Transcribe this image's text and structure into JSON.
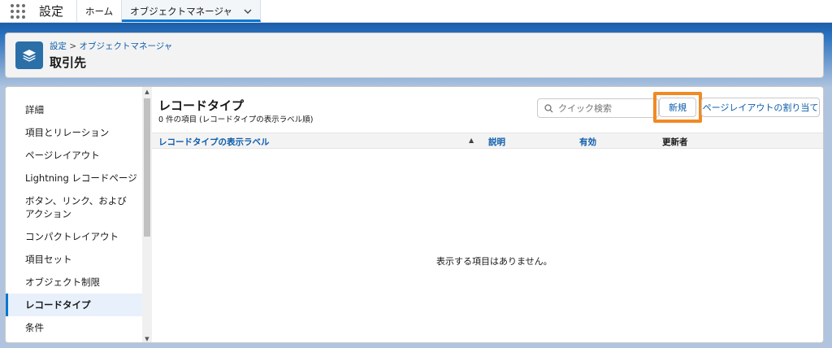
{
  "app": {
    "name": "設定"
  },
  "nav": {
    "tabs": [
      {
        "label": "ホーム"
      },
      {
        "label": "オブジェクトマネージャ"
      }
    ]
  },
  "header": {
    "breadcrumb_setup": "設定",
    "breadcrumb_sep": ">",
    "breadcrumb_objmgr": "オブジェクトマネージャ",
    "title": "取引先"
  },
  "sidebar": {
    "items": [
      {
        "label": "詳細"
      },
      {
        "label": "項目とリレーション"
      },
      {
        "label": "ページレイアウト"
      },
      {
        "label": "Lightning レコードページ"
      },
      {
        "label": "ボタン、リンク、およびアクション"
      },
      {
        "label": "コンパクトレイアウト"
      },
      {
        "label": "項目セット"
      },
      {
        "label": "オブジェクト制限"
      },
      {
        "label": "レコードタイプ"
      },
      {
        "label": "条件"
      }
    ]
  },
  "main": {
    "title": "レコードタイプ",
    "subtitle": "0 件の項目 (レコードタイプの表示ラベル順)",
    "search_placeholder": "クイック検索",
    "new_button": "新規",
    "layout_button": "ページレイアウトの割り当て",
    "columns": [
      {
        "label": "レコードタイプの表示ラベル"
      },
      {
        "label": "説明"
      },
      {
        "label": "有効"
      },
      {
        "label": "更新者"
      }
    ],
    "sort_arrow": "▲",
    "empty_message": "表示する項目はありません。"
  },
  "colors": {
    "accent": "#0176d3",
    "link": "#0b5cab",
    "highlight": "#f08a24",
    "object_icon": "#2b6fa8"
  }
}
